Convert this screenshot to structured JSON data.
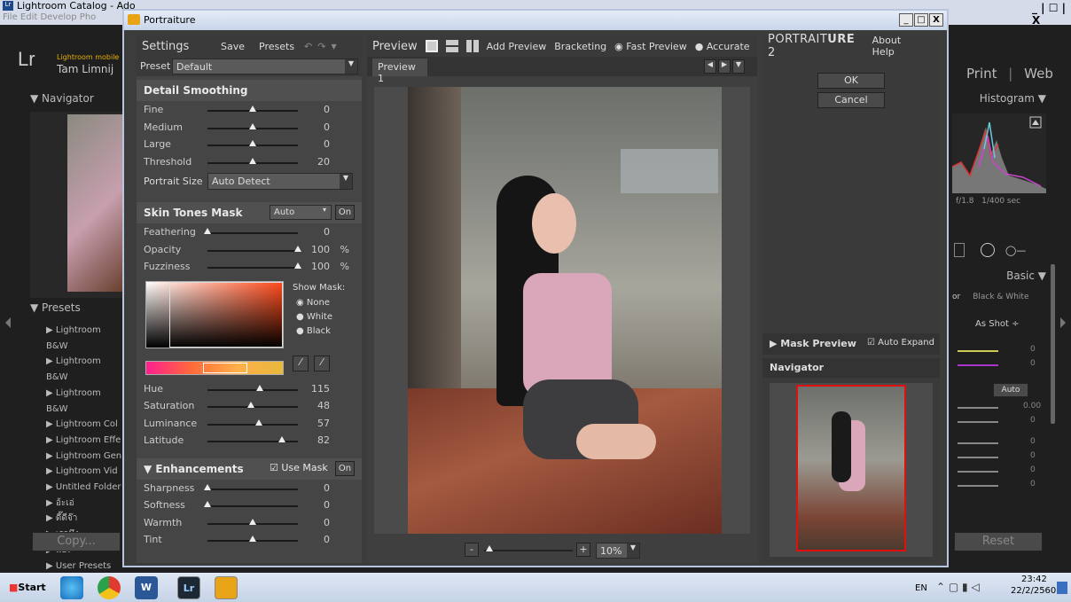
{
  "lightroom": {
    "title": "Lightroom Catalog - Ado",
    "menu": "File  Edit  Develop  Pho",
    "mobile_label": "Lightroom mobile",
    "user": "Tam Limnij",
    "navigator": "Navigator",
    "presets_header": "Presets",
    "presets": [
      "Lightroom B&W",
      "Lightroom B&W",
      "Lightroom B&W",
      "Lightroom Col",
      "Lightroom Effe",
      "Lightroom Gen",
      "Lightroom Vid",
      "Untitled Folder",
      "อ้ะเอ่",
      "ดี๊ดีจ๊า",
      "เรามึง",
      "แอะ",
      "User Presets"
    ],
    "copy": "Copy...",
    "modules": {
      "print": "Print",
      "web": "Web"
    },
    "histogram": "Histogram",
    "aperture": "f/1.8",
    "shutter": "1/400 sec",
    "basic": "Basic",
    "bw": "Black & White",
    "wb": "As Shot",
    "auto": "Auto",
    "vals": [
      "0",
      "0",
      "0.00",
      "0",
      "0",
      "0",
      "0",
      "0"
    ],
    "reset": "Reset",
    "win_controls": "_ | ☐ | X"
  },
  "portraiture": {
    "window_title": "Portraiture",
    "settings": "Settings",
    "save": "Save",
    "presets": "Presets",
    "preset_label": "Preset",
    "preset_value": "Default",
    "detail_smoothing": {
      "title": "Detail Smoothing",
      "rows": [
        {
          "label": "Fine",
          "value": "0",
          "level": 50
        },
        {
          "label": "Medium",
          "value": "0",
          "level": 50
        },
        {
          "label": "Large",
          "value": "0",
          "level": 50
        },
        {
          "label": "Threshold",
          "value": "20",
          "level": 50
        }
      ],
      "portrait_size_label": "Portrait Size",
      "portrait_size_value": "Auto Detect"
    },
    "skin_mask": {
      "title": "Skin Tones Mask",
      "mode": "Auto",
      "on": "On",
      "rows": [
        {
          "label": "Feathering",
          "value": "0",
          "pct": "",
          "level": 0
        },
        {
          "label": "Opacity",
          "value": "100",
          "pct": "%",
          "level": 100
        },
        {
          "label": "Fuzziness",
          "value": "100",
          "pct": "%",
          "level": 100
        }
      ],
      "show_mask": "Show Mask:",
      "options": [
        "None",
        "White",
        "Black"
      ],
      "hsl": [
        {
          "label": "Hue",
          "value": "115",
          "level": 58
        },
        {
          "label": "Saturation",
          "value": "48",
          "level": 48
        },
        {
          "label": "Luminance",
          "value": "57",
          "level": 57
        },
        {
          "label": "Latitude",
          "value": "82",
          "level": 82
        }
      ]
    },
    "enhancements": {
      "title": "Enhancements",
      "use_mask": "Use Mask",
      "on": "On",
      "rows": [
        {
          "label": "Sharpness",
          "value": "0",
          "level": 0
        },
        {
          "label": "Softness",
          "value": "0",
          "level": 0
        },
        {
          "label": "Warmth",
          "value": "0",
          "level": 50
        },
        {
          "label": "Tint",
          "value": "0",
          "level": 50
        }
      ]
    },
    "preview": {
      "label": "Preview",
      "add_preview": "Add Preview",
      "bracketing": "Bracketing",
      "fast": "Fast Preview",
      "accurate": "Accurate",
      "tab": "Preview 1",
      "zoom": "10%"
    },
    "brand": {
      "a": "PORTRAIT",
      "b": "URE",
      "c": "2"
    },
    "about": "About",
    "help": "Help",
    "ok": "OK",
    "cancel": "Cancel",
    "mask_preview": "Mask Preview",
    "auto_expand": "Auto Expand",
    "navigator": "Navigator"
  },
  "taskbar": {
    "start": "Start",
    "lang": "EN",
    "time": "23:42",
    "date": "22/2/2560"
  }
}
